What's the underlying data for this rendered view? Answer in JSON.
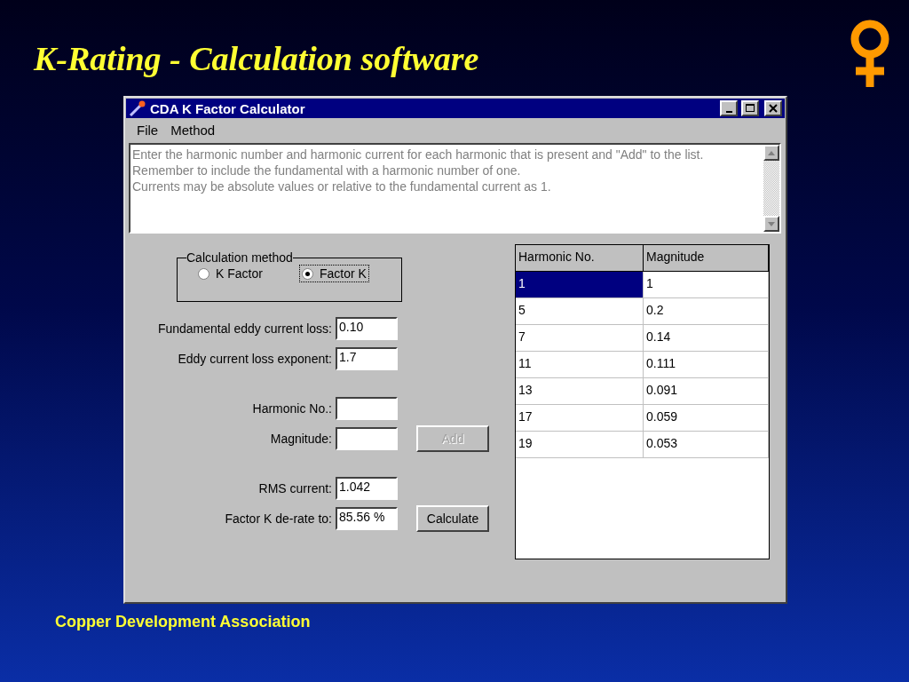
{
  "slide": {
    "title": "K-Rating - Calculation software",
    "footer": "Copper Development Association"
  },
  "window": {
    "title": "CDA K Factor Calculator"
  },
  "menu": [
    "File",
    "Method"
  ],
  "instructions": [
    "Enter the harmonic number and harmonic current for each harmonic that is present and \"Add\" to the list.",
    "Remember to include the fundamental with a harmonic number of one.",
    "Currents may be absolute values or relative to the fundamental current as 1."
  ],
  "calculation_method": {
    "label": "Calculation method",
    "options": [
      {
        "label": "K Factor",
        "selected": false
      },
      {
        "label": "Factor K",
        "selected": true
      }
    ]
  },
  "settings": [
    {
      "label": "Fundamental eddy current loss:",
      "value": "0.10"
    },
    {
      "label": "Eddy current loss exponent:",
      "value": "1.7"
    }
  ],
  "entry": {
    "fields": [
      {
        "label": "Harmonic No.:"
      },
      {
        "label": "Magnitude:"
      }
    ],
    "button": {
      "label": "Add",
      "disabled": true
    }
  },
  "results": {
    "fields": [
      {
        "label": "RMS current:",
        "value": "1.042"
      },
      {
        "label": "Factor K de-rate to:",
        "value": "85.56 %"
      }
    ],
    "button": {
      "label": "Calculate",
      "disabled": false
    }
  },
  "table": {
    "columns": [
      "Harmonic No.",
      "Magnitude"
    ],
    "rows": [
      {
        "cells": [
          "1",
          "1"
        ],
        "selected": true
      },
      {
        "cells": [
          "5",
          "0.2"
        ],
        "selected": false
      },
      {
        "cells": [
          "7",
          "0.14"
        ],
        "selected": false
      },
      {
        "cells": [
          "11",
          "0.111"
        ],
        "selected": false
      },
      {
        "cells": [
          "13",
          "0.091"
        ],
        "selected": false
      },
      {
        "cells": [
          "17",
          "0.059"
        ],
        "selected": false
      },
      {
        "cells": [
          "19",
          "0.053"
        ],
        "selected": false
      }
    ]
  }
}
